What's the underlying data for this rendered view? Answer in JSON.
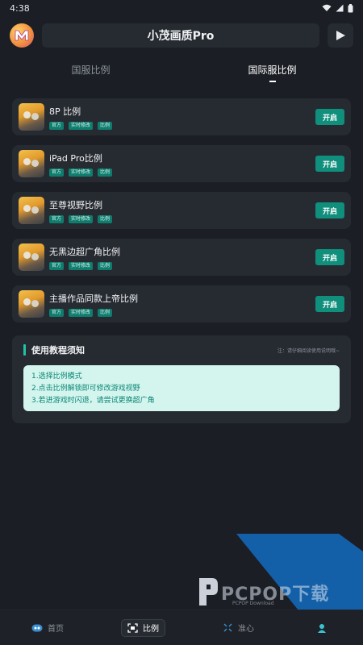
{
  "status": {
    "time": "4:38"
  },
  "header": {
    "title": "小茂画质Pro"
  },
  "tabs": [
    {
      "label": "国服比例",
      "active": false
    },
    {
      "label": "国际服比例",
      "active": true
    }
  ],
  "cards": [
    {
      "title": "8P 比例",
      "tags": [
        "官方",
        "实时修改",
        "比例"
      ],
      "button": "开启"
    },
    {
      "title": "iPad Pro比例",
      "tags": [
        "官方",
        "实时修改",
        "比例"
      ],
      "button": "开启"
    },
    {
      "title": "至尊视野比例",
      "tags": [
        "官方",
        "实时修改",
        "比例"
      ],
      "button": "开启"
    },
    {
      "title": "无黑边超广角比例",
      "tags": [
        "官方",
        "实时修改",
        "比例"
      ],
      "button": "开启"
    },
    {
      "title": "主播作品同款上帝比例",
      "tags": [
        "官方",
        "实时修改",
        "比例"
      ],
      "button": "开启"
    }
  ],
  "guide": {
    "title": "使用教程须知",
    "note": "注：请仔细阅读使用说明哦~",
    "lines": [
      "1.选择比例模式",
      "2.点击比例解锁即可修改游戏视野",
      "3.若进游戏时闪退，请尝试更换超广角"
    ]
  },
  "watermark": {
    "text": "PCPOP下载",
    "sub": "PCPOP Download"
  },
  "nav": [
    {
      "label": "首页",
      "icon": "home-icon",
      "active": false
    },
    {
      "label": "比例",
      "icon": "ratio-icon",
      "active": true
    },
    {
      "label": "准心",
      "icon": "crosshair-icon",
      "active": false
    },
    {
      "label": "",
      "icon": "user-icon",
      "active": false
    }
  ],
  "colors": {
    "accent": "#0f8f7c",
    "background": "#1b1e24",
    "card": "#262a31"
  }
}
